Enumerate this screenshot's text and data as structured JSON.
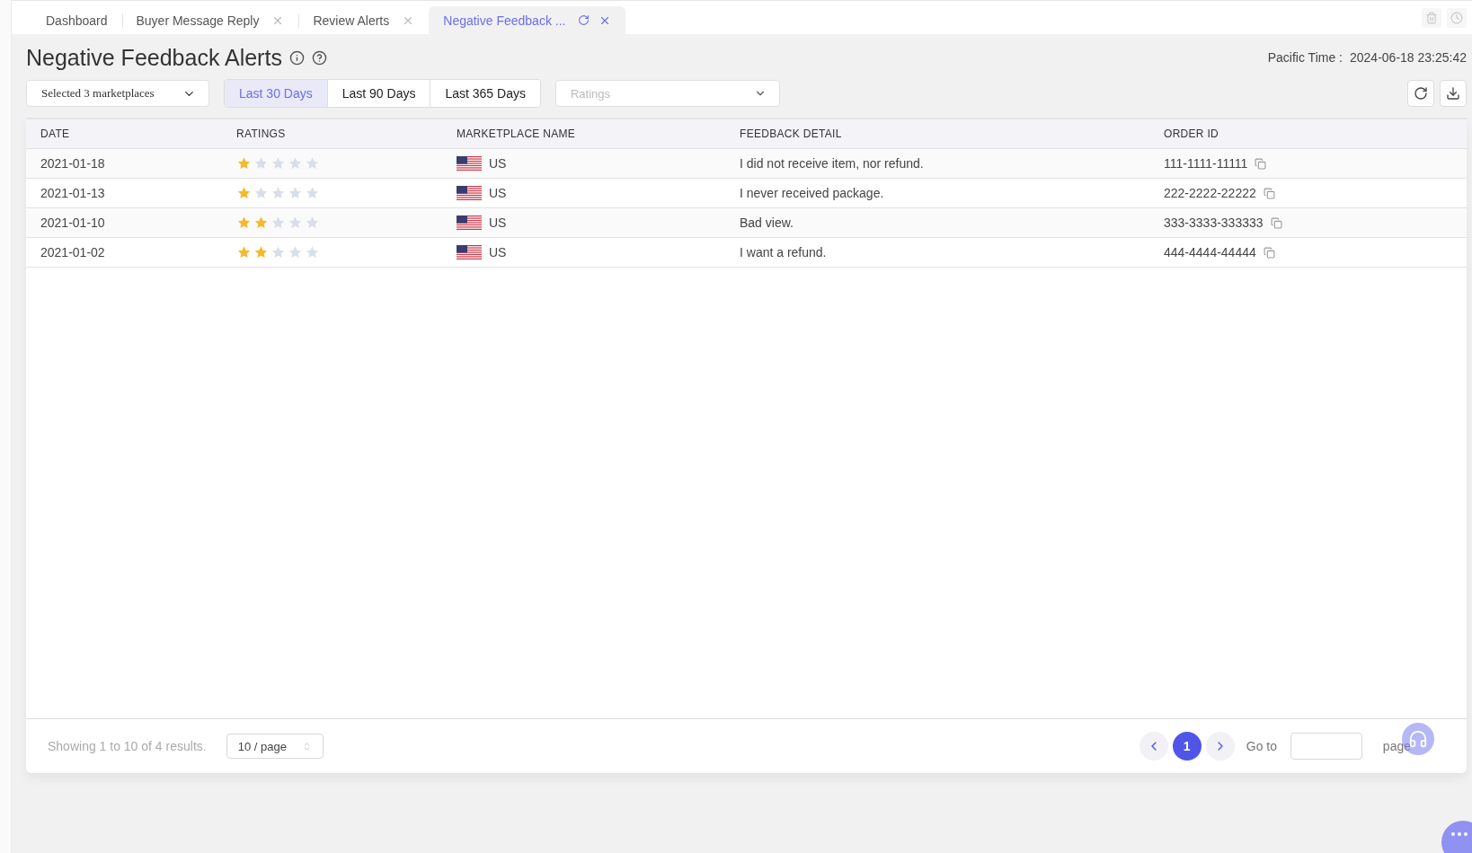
{
  "tabs": [
    {
      "label": "Dashboard",
      "selected": false,
      "closable": false,
      "refreshable": false
    },
    {
      "label": "Buyer Message Reply",
      "selected": false,
      "closable": true,
      "refreshable": false
    },
    {
      "label": "Review Alerts",
      "selected": false,
      "closable": true,
      "refreshable": false
    },
    {
      "label": "Negative Feedback ...",
      "selected": true,
      "closable": true,
      "refreshable": true
    }
  ],
  "page": {
    "title": "Negative Feedback Alerts",
    "time_label": "Pacific Time :",
    "time_value": "2024-06-18 23:25:42"
  },
  "filters": {
    "marketplaces": "Selected 3 marketplaces",
    "ranges": [
      {
        "label": "Last 30 Days",
        "selected": true
      },
      {
        "label": "Last 90 Days",
        "selected": false
      },
      {
        "label": "Last 365 Days",
        "selected": false
      }
    ],
    "ratings": {
      "placeholder": "Ratings"
    }
  },
  "table": {
    "columns": [
      "DATE",
      "RATINGS",
      "MARKETPLACE NAME",
      "FEEDBACK DETAIL",
      "ORDER ID"
    ],
    "rows": [
      {
        "date": "2021-01-18",
        "stars": 1,
        "marketplace": "US",
        "feedback": "I did not receive item, nor refund.",
        "order_id": "111-1111-11111"
      },
      {
        "date": "2021-01-13",
        "stars": 1,
        "marketplace": "US",
        "feedback": "I never received package.",
        "order_id": "222-2222-22222"
      },
      {
        "date": "2021-01-10",
        "stars": 2,
        "marketplace": "US",
        "feedback": "Bad view.",
        "order_id": "333-3333-333333"
      },
      {
        "date": "2021-01-02",
        "stars": 2,
        "marketplace": "US",
        "feedback": "I want a refund.",
        "order_id": "444-4444-44444"
      }
    ]
  },
  "footer": {
    "summary": "Showing 1 to 10 of 4 results.",
    "page_size": "10 / page",
    "pages": [
      {
        "label": "1",
        "selected": true
      }
    ],
    "goto_label": "Go to",
    "page_label": "page"
  }
}
